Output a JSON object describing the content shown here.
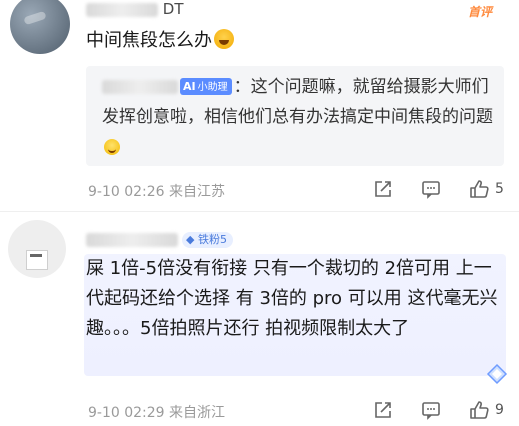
{
  "comment1": {
    "username": "DT",
    "hot_badge": "首评",
    "text": "中间焦段怎么办",
    "emoji": "laugh-cry-emoji",
    "reply": {
      "ai_badge_label": "小助理",
      "text": "：这个问题嘛，就留给摄影大师们发挥创意啦，相信他们总有办法搞定中间焦段的问题"
    },
    "meta": "9-10 02:26 来自江苏",
    "actions": {
      "like_count": "5"
    }
  },
  "comment2": {
    "fan_badge_label": "铁粉5",
    "text": "屎 1倍-5倍没有衔接 只有一个裁切的 2倍可用 上一代起码还给个选择 有 3倍的 pro 可以用 这代毫无兴趣。。。5倍拍照片还行 拍视频限制太大了",
    "meta": "9-10 02:29 来自浙江",
    "actions": {
      "like_count": "9"
    }
  },
  "colors": {
    "accent": "#5b8cff",
    "hot": "#ff8a3d",
    "meta": "#9a9a9a"
  }
}
